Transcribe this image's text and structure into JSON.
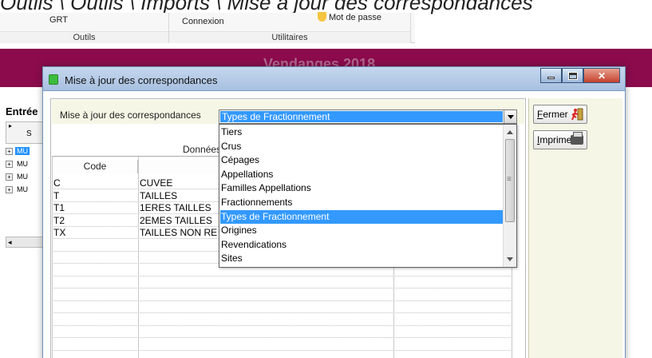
{
  "caption": "Outils \\ Outils \\ Imports \\ Mise à jour des correspondances",
  "ribbon": {
    "groups": [
      {
        "button": "GRT",
        "label": "Outils"
      },
      {
        "button": "Connexion",
        "button2": "Mot de passe",
        "label": "Utilitaires"
      }
    ]
  },
  "banner": {
    "title": "Vendanges 2018"
  },
  "background": {
    "section_title": "Entrée",
    "header_letter": "S",
    "rows": [
      "MU",
      "MU",
      "MU",
      "MU"
    ],
    "scroll_arrow": "◂"
  },
  "dialog": {
    "title": "Mise à jour des correspondances",
    "filter_label": "Mise à jour des correspondances",
    "combo_value": "Types de Fractionnement",
    "grid_title": "Données",
    "columns": [
      "Code",
      ""
    ],
    "rows": [
      {
        "code": "C",
        "label": "CUVEE"
      },
      {
        "code": "T",
        "label": "TAILLES"
      },
      {
        "code": "T1",
        "label": "1ERES TAILLES"
      },
      {
        "code": "T2",
        "label": "2EMES TAILLES"
      },
      {
        "code": "TX",
        "label": "TAILLES NON RE"
      }
    ],
    "buttons": {
      "close": {
        "hotkey": "F",
        "rest": "ermer"
      },
      "print": {
        "hotkey": "I",
        "rest": "mprimer"
      }
    },
    "dropdown_items": [
      "Tiers",
      "Crus",
      "Cépages",
      "Appellations",
      "Familles Appellations",
      "Fractionnements",
      "Types de Fractionnement",
      "Origines",
      "Revendications",
      "Sites"
    ],
    "dropdown_selected_index": 6
  },
  "colors": {
    "banner": "#8b0b4d",
    "selection": "#3399ff",
    "panel": "#f6f6e6"
  }
}
